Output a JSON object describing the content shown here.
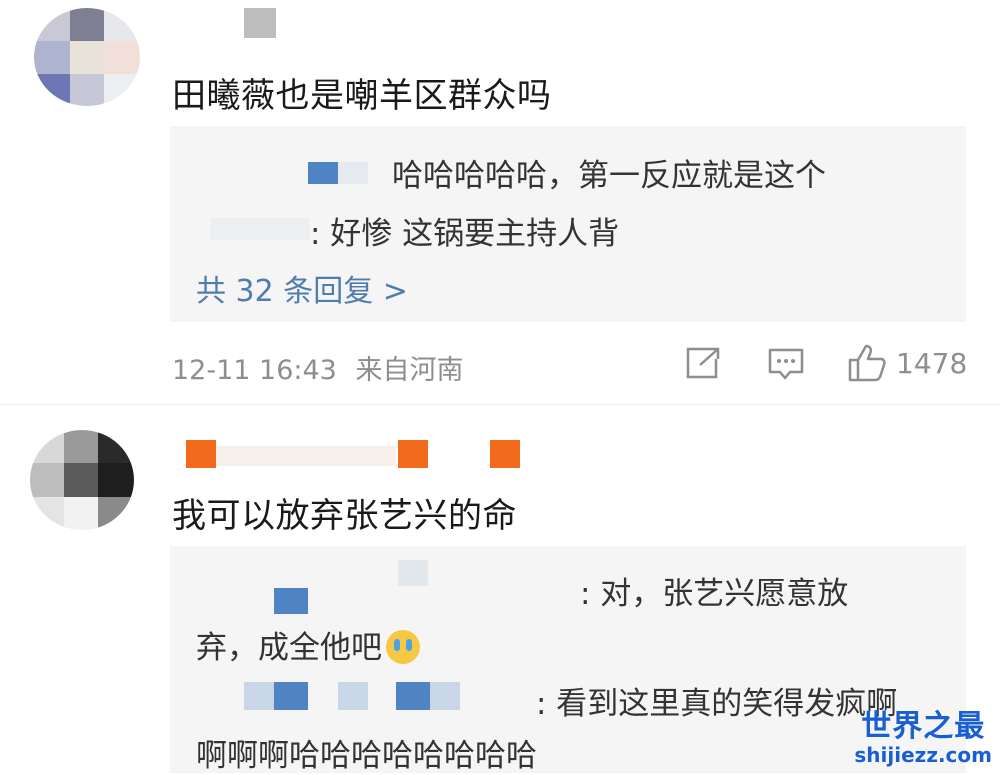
{
  "comments": [
    {
      "text": "田曦薇也是嘲羊区群众吗",
      "replies": [
        {
          "text": "哈哈哈哈哈，第一反应就是这个"
        },
        {
          "text": ": 好惨 这锅要主持人背"
        }
      ],
      "more_replies": "共 32 条回复 >",
      "timestamp": "12-11 16:43",
      "source": "来自河南",
      "likes": "1478"
    },
    {
      "text": "我可以放弃张艺兴的命",
      "replies": [
        {
          "text_line1": ": 对，张艺兴愿意放",
          "text_line2": "弃，成全他吧"
        },
        {
          "text_line1": ": 看到这里真的笑得发疯啊",
          "text_line2": "啊啊啊哈哈哈哈哈哈哈哈"
        }
      ]
    }
  ],
  "icons": {
    "share": "share-icon",
    "comment": "comment-icon",
    "like": "like-icon",
    "emoji": "crying-emoji-icon"
  },
  "colors": {
    "link": "#507daf",
    "meta": "#8e8e8e",
    "reply_bg": "#f5f5f5",
    "username_pixel": "#f26a1b",
    "watermark": "#1a5fd1"
  },
  "watermark": {
    "cn": "世界之最",
    "en": "shijiezz.com"
  }
}
